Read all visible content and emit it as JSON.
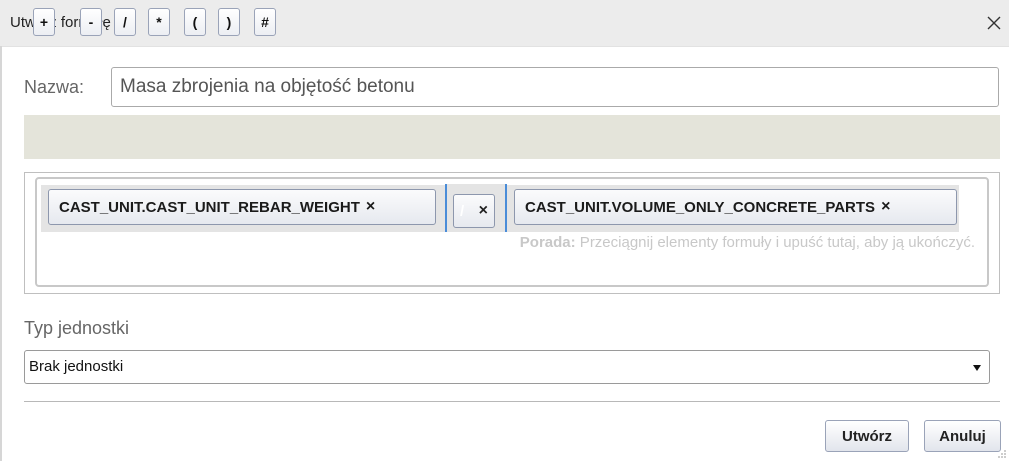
{
  "dialog": {
    "title": "Utwórz formułę",
    "close_icon": "close-icon"
  },
  "name": {
    "label": "Nazwa:",
    "value": "Masa zbrojenia na objętość betonu"
  },
  "operators": [
    "+",
    "-",
    "/",
    "*",
    "(",
    ")",
    "#"
  ],
  "formula": {
    "hint_bold": "Porada:",
    "hint_text": " Przeciągnij elementy formuły i upuść tutaj, aby ją ukończyć.",
    "tokens": [
      {
        "label": "CAST_UNIT.CAST_UNIT_REBAR_WEIGHT",
        "remove": "×"
      },
      {
        "label": "/",
        "remove": "×"
      },
      {
        "label": "CAST_UNIT.VOLUME_ONLY_CONCRETE_PARTS",
        "remove": "×"
      }
    ]
  },
  "unit": {
    "label": "Typ jednostki",
    "selected": "Brak jednostki"
  },
  "actions": {
    "create": "Utwórz",
    "cancel": "Anuluj"
  },
  "colors": {
    "titlebar": "#ececec",
    "operator_bar": "#e4e4da",
    "drop_indicator": "#4a8cd8"
  }
}
